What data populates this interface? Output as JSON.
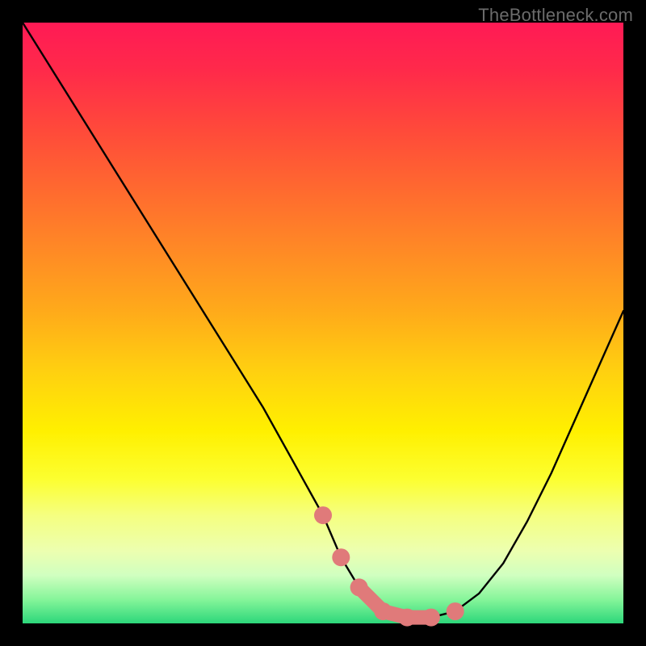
{
  "watermark": "TheBottleneck.com",
  "chart_data": {
    "type": "line",
    "title": "",
    "xlabel": "",
    "ylabel": "",
    "xlim": [
      0,
      100
    ],
    "ylim": [
      0,
      100
    ],
    "series": [
      {
        "name": "bottleneck-curve",
        "x": [
          0,
          5,
          10,
          15,
          20,
          25,
          30,
          35,
          40,
          45,
          50,
          53,
          56,
          60,
          64,
          68,
          72,
          76,
          80,
          84,
          88,
          92,
          96,
          100
        ],
        "values": [
          100,
          92,
          84,
          76,
          68,
          60,
          52,
          44,
          36,
          27,
          18,
          11,
          6,
          2,
          1,
          1,
          2,
          5,
          10,
          17,
          25,
          34,
          43,
          52
        ]
      }
    ],
    "markers": {
      "name": "highlight-dots",
      "x": [
        50,
        53,
        56,
        60,
        64,
        68,
        72
      ],
      "values": [
        18,
        11,
        6,
        2,
        1,
        1,
        2
      ],
      "color": "#e07a7a"
    },
    "background_gradient": [
      "#ff1a55",
      "#ffd010",
      "#2cd77a"
    ]
  }
}
